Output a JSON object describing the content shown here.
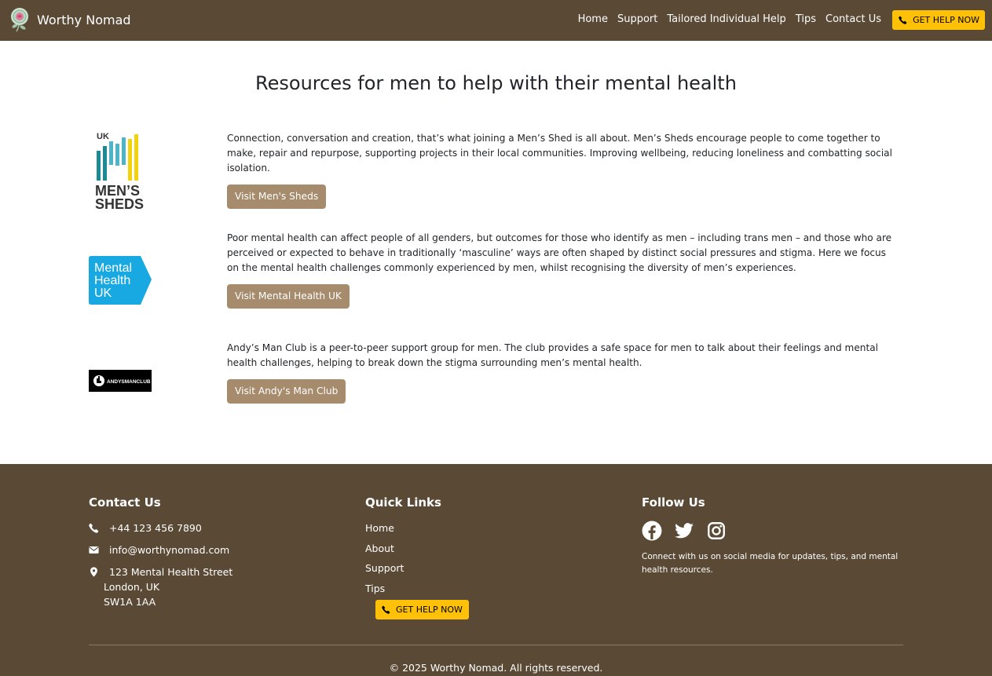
{
  "colors": {
    "brand_bg": "#5a4a35",
    "accent": "#ffc107",
    "button": "#a68b6d"
  },
  "nav": {
    "brand": "Worthy Nomad",
    "links": [
      "Home",
      "Support",
      "Tailored Individual Help",
      "Tips",
      "Contact Us"
    ],
    "cta": "GET HELP NOW"
  },
  "main": {
    "title": "Resources for men to help with their mental health",
    "resources": [
      {
        "logo_text": [
          "UK",
          "MEN’S",
          "SHEDS"
        ],
        "description": "Connection, conversation and creation, that’s what joining a Men’s Shed is all about. Men’s Sheds encourage people to come together to make, repair and repurpose, supporting projects in their local communities. Improving wellbeing, reducing loneliness and combatting social isolation.",
        "button": "Visit Men's Sheds"
      },
      {
        "logo_text": [
          "Mental",
          "Health",
          "UK"
        ],
        "description": "Poor mental health can affect people of all genders, but outcomes for those who identify as men – including trans men – and those who are perceived or expected to behave in traditionally ‘masculine’ ways are often shaped by distinct social pressures and stigma. Here we focus on the mental health challenges commonly experienced by men, whilst recognising the diversity of men’s experiences.",
        "button": "Visit Mental Health UK"
      },
      {
        "logo_text": [
          "ANDYSMANCLUB"
        ],
        "description": "Andy’s Man Club is a peer-to-peer support group for men. The club provides a safe space for men to talk about their feelings and mental health challenges, helping to break down the stigma surrounding men’s mental health.",
        "button": "Visit Andy's Man Club"
      }
    ]
  },
  "footer": {
    "contact": {
      "heading": "Contact Us",
      "phone": "+44 123 456 7890",
      "email": "info@worthynomad.com",
      "address": [
        "123 Mental Health Street",
        "London, UK",
        "SW1A 1AA"
      ]
    },
    "quick_links": {
      "heading": "Quick Links",
      "links": [
        "Home",
        "About",
        "Support",
        "Tips"
      ],
      "cta": "GET HELP NOW"
    },
    "follow": {
      "heading": "Follow Us",
      "icons": [
        "facebook-icon",
        "twitter-icon",
        "instagram-icon"
      ],
      "text": "Connect with us on social media for updates, tips, and mental health resources."
    },
    "copyright": "© 2025 Worthy Nomad. All rights reserved."
  }
}
